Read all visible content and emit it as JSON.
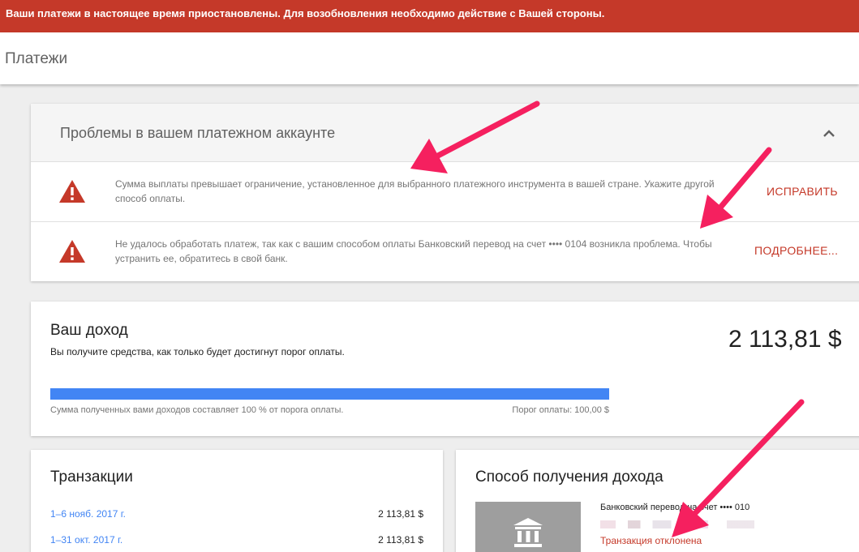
{
  "alert": {
    "text": "Ваши платежи в настоящее время приостановлены. Для возобновления необходимо действие с Вашей стороны."
  },
  "header": {
    "title": "Платежи"
  },
  "problems": {
    "title": "Проблемы в вашем платежном аккаунте",
    "collapse_icon": "chevron-up-icon",
    "issues": [
      {
        "icon": "warning-icon",
        "message": "Сумма выплаты превышает ограничение, установленное для выбранного платежного инструмента в вашей стране. Укажите другой способ оплаты.",
        "action": "ИСПРАВИТЬ"
      },
      {
        "icon": "warning-icon",
        "message": "Не удалось обработать платеж, так как с вашим способом оплаты Банковский перевод на счет •••• 0104 возникла проблема. Чтобы устранить ее, обратитесь в свой банк.",
        "action": "ПОДРОБНЕЕ..."
      }
    ]
  },
  "income": {
    "title": "Ваш доход",
    "subtitle": "Вы получите средства, как только будет достигнут порог оплаты.",
    "amount": "2 113,81 $",
    "progress_fraction": 1.0,
    "progress_caption": "Сумма полученных вами доходов составляет 100 % от порога оплаты.",
    "threshold_caption": "Порог оплаты: 100,00 $"
  },
  "transactions": {
    "title": "Транзакции",
    "rows": [
      {
        "date": "1–6 нояб. 2017 г.",
        "amount": "2 113,81 $"
      },
      {
        "date": "1–31 окт. 2017 г.",
        "amount": "2 113,81 $"
      }
    ]
  },
  "method": {
    "title": "Способ получения дохода",
    "icon": "bank-icon",
    "account": "Банковский перевод на счет •••• 010",
    "status": "Транзакция отклонена"
  },
  "colors": {
    "alert_red": "#c53929",
    "progress_blue": "#4285f4",
    "annotation_pink": "#f5205f"
  }
}
